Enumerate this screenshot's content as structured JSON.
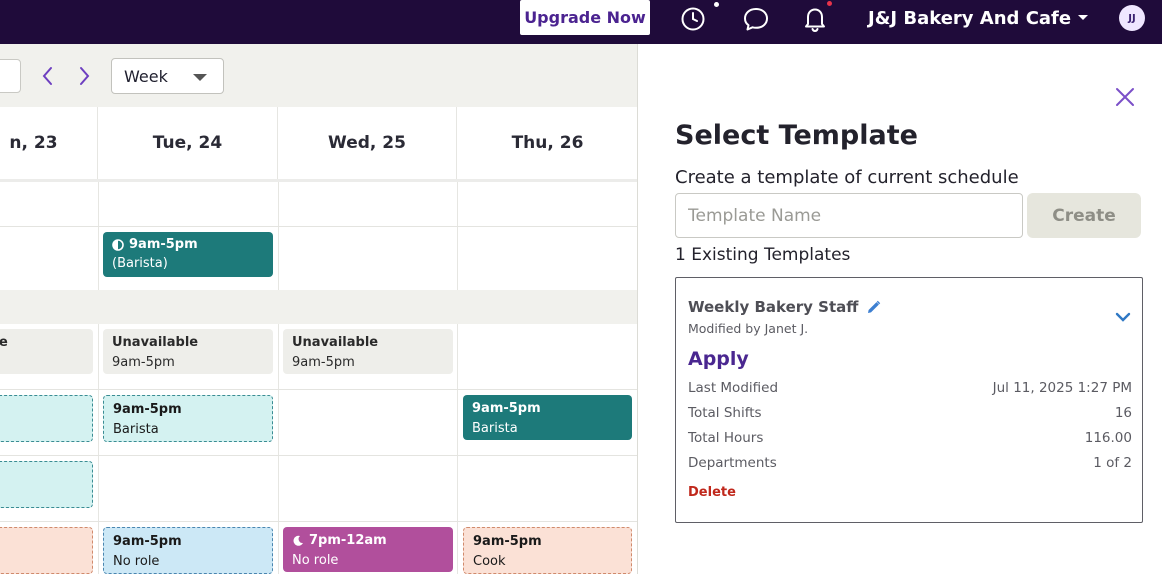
{
  "topbar": {
    "upgrade_label": "Upgrade Now",
    "company_name": "J&J Bakery And Cafe",
    "avatar_initials": "JJ"
  },
  "schedule": {
    "view_select": "Week",
    "days": [
      "n, 23",
      "Tue, 24",
      "Wed, 25",
      "Thu, 26"
    ],
    "row2": {
      "time": "9am-5pm",
      "role": "(Barista)"
    },
    "unavailable": [
      {
        "title": "e",
        "time": ""
      },
      {
        "title": "Unavailable",
        "time": "9am-5pm"
      },
      {
        "title": "Unavailable",
        "time": "9am-5pm"
      }
    ],
    "shift_tue_barista": {
      "time": "9am-5pm",
      "role": "Barista"
    },
    "shift_thu_barista": {
      "time": "9am-5pm",
      "role": "Barista"
    },
    "shift_tue_norole": {
      "time": "9am-5pm",
      "role": "No role"
    },
    "shift_wed_norole": {
      "time": "7pm-12am",
      "role": "No role"
    },
    "shift_thu_cook": {
      "time": "9am-5pm",
      "role": "Cook"
    }
  },
  "panel": {
    "title": "Select Template",
    "subtitle": "Create a template of current schedule",
    "input_placeholder": "Template Name",
    "create_label": "Create",
    "existing_label": "1 Existing Templates",
    "template": {
      "name": "Weekly Bakery Staff",
      "modified_by": "Modified by Janet J.",
      "apply_label": "Apply",
      "stats": [
        {
          "label": "Last Modified",
          "value": "Jul 11, 2025 1:27 PM"
        },
        {
          "label": "Total Shifts",
          "value": "16"
        },
        {
          "label": "Total Hours",
          "value": "116.00"
        },
        {
          "label": "Departments",
          "value": "1 of 2"
        }
      ],
      "delete_label": "Delete"
    }
  },
  "colors": {
    "topbar": "#1f0b3a",
    "accent_purple": "#4a2790",
    "teal_shift": "#1d7a7a",
    "purple_shift": "#b14f9c",
    "delete_red": "#c0281c"
  }
}
